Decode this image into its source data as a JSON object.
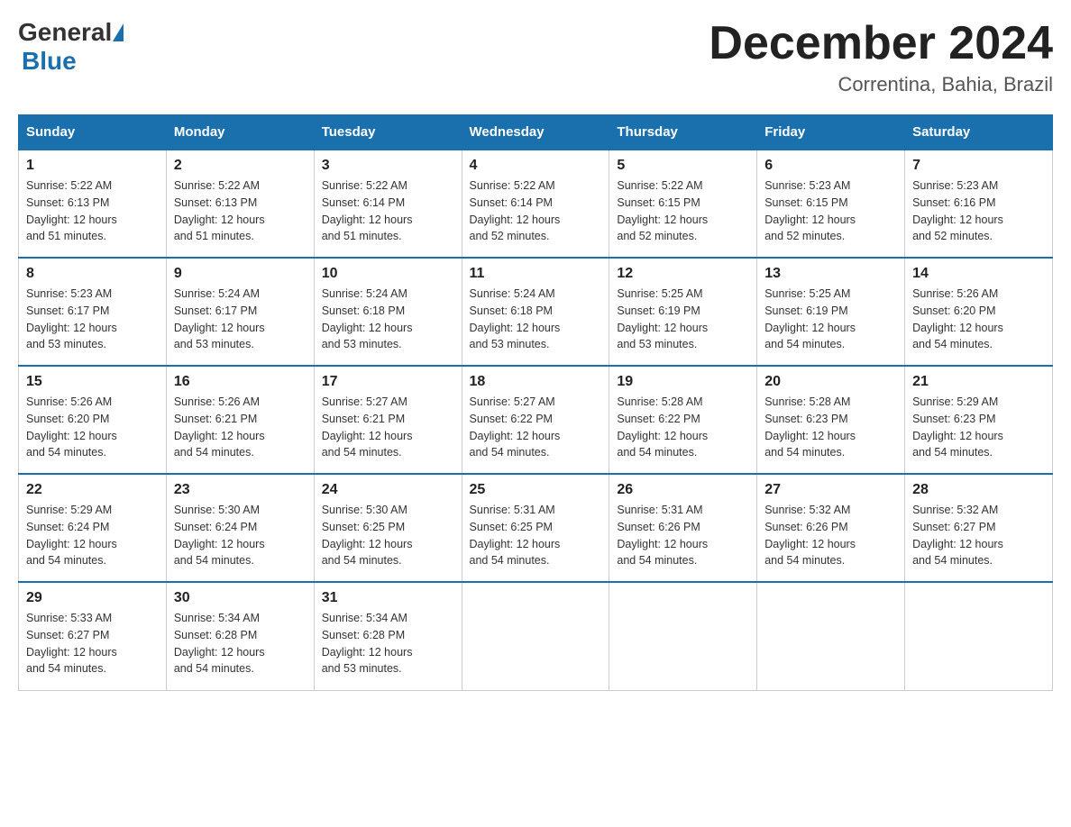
{
  "header": {
    "logo": {
      "general": "General",
      "blue": "Blue"
    },
    "title": "December 2024",
    "location": "Correntina, Bahia, Brazil"
  },
  "days_of_week": [
    "Sunday",
    "Monday",
    "Tuesday",
    "Wednesday",
    "Thursday",
    "Friday",
    "Saturday"
  ],
  "weeks": [
    [
      {
        "day": "1",
        "sunrise": "5:22 AM",
        "sunset": "6:13 PM",
        "daylight": "12 hours and 51 minutes."
      },
      {
        "day": "2",
        "sunrise": "5:22 AM",
        "sunset": "6:13 PM",
        "daylight": "12 hours and 51 minutes."
      },
      {
        "day": "3",
        "sunrise": "5:22 AM",
        "sunset": "6:14 PM",
        "daylight": "12 hours and 51 minutes."
      },
      {
        "day": "4",
        "sunrise": "5:22 AM",
        "sunset": "6:14 PM",
        "daylight": "12 hours and 52 minutes."
      },
      {
        "day": "5",
        "sunrise": "5:22 AM",
        "sunset": "6:15 PM",
        "daylight": "12 hours and 52 minutes."
      },
      {
        "day": "6",
        "sunrise": "5:23 AM",
        "sunset": "6:15 PM",
        "daylight": "12 hours and 52 minutes."
      },
      {
        "day": "7",
        "sunrise": "5:23 AM",
        "sunset": "6:16 PM",
        "daylight": "12 hours and 52 minutes."
      }
    ],
    [
      {
        "day": "8",
        "sunrise": "5:23 AM",
        "sunset": "6:17 PM",
        "daylight": "12 hours and 53 minutes."
      },
      {
        "day": "9",
        "sunrise": "5:24 AM",
        "sunset": "6:17 PM",
        "daylight": "12 hours and 53 minutes."
      },
      {
        "day": "10",
        "sunrise": "5:24 AM",
        "sunset": "6:18 PM",
        "daylight": "12 hours and 53 minutes."
      },
      {
        "day": "11",
        "sunrise": "5:24 AM",
        "sunset": "6:18 PM",
        "daylight": "12 hours and 53 minutes."
      },
      {
        "day": "12",
        "sunrise": "5:25 AM",
        "sunset": "6:19 PM",
        "daylight": "12 hours and 53 minutes."
      },
      {
        "day": "13",
        "sunrise": "5:25 AM",
        "sunset": "6:19 PM",
        "daylight": "12 hours and 54 minutes."
      },
      {
        "day": "14",
        "sunrise": "5:26 AM",
        "sunset": "6:20 PM",
        "daylight": "12 hours and 54 minutes."
      }
    ],
    [
      {
        "day": "15",
        "sunrise": "5:26 AM",
        "sunset": "6:20 PM",
        "daylight": "12 hours and 54 minutes."
      },
      {
        "day": "16",
        "sunrise": "5:26 AM",
        "sunset": "6:21 PM",
        "daylight": "12 hours and 54 minutes."
      },
      {
        "day": "17",
        "sunrise": "5:27 AM",
        "sunset": "6:21 PM",
        "daylight": "12 hours and 54 minutes."
      },
      {
        "day": "18",
        "sunrise": "5:27 AM",
        "sunset": "6:22 PM",
        "daylight": "12 hours and 54 minutes."
      },
      {
        "day": "19",
        "sunrise": "5:28 AM",
        "sunset": "6:22 PM",
        "daylight": "12 hours and 54 minutes."
      },
      {
        "day": "20",
        "sunrise": "5:28 AM",
        "sunset": "6:23 PM",
        "daylight": "12 hours and 54 minutes."
      },
      {
        "day": "21",
        "sunrise": "5:29 AM",
        "sunset": "6:23 PM",
        "daylight": "12 hours and 54 minutes."
      }
    ],
    [
      {
        "day": "22",
        "sunrise": "5:29 AM",
        "sunset": "6:24 PM",
        "daylight": "12 hours and 54 minutes."
      },
      {
        "day": "23",
        "sunrise": "5:30 AM",
        "sunset": "6:24 PM",
        "daylight": "12 hours and 54 minutes."
      },
      {
        "day": "24",
        "sunrise": "5:30 AM",
        "sunset": "6:25 PM",
        "daylight": "12 hours and 54 minutes."
      },
      {
        "day": "25",
        "sunrise": "5:31 AM",
        "sunset": "6:25 PM",
        "daylight": "12 hours and 54 minutes."
      },
      {
        "day": "26",
        "sunrise": "5:31 AM",
        "sunset": "6:26 PM",
        "daylight": "12 hours and 54 minutes."
      },
      {
        "day": "27",
        "sunrise": "5:32 AM",
        "sunset": "6:26 PM",
        "daylight": "12 hours and 54 minutes."
      },
      {
        "day": "28",
        "sunrise": "5:32 AM",
        "sunset": "6:27 PM",
        "daylight": "12 hours and 54 minutes."
      }
    ],
    [
      {
        "day": "29",
        "sunrise": "5:33 AM",
        "sunset": "6:27 PM",
        "daylight": "12 hours and 54 minutes."
      },
      {
        "day": "30",
        "sunrise": "5:34 AM",
        "sunset": "6:28 PM",
        "daylight": "12 hours and 54 minutes."
      },
      {
        "day": "31",
        "sunrise": "5:34 AM",
        "sunset": "6:28 PM",
        "daylight": "12 hours and 53 minutes."
      },
      null,
      null,
      null,
      null
    ]
  ],
  "labels": {
    "sunrise": "Sunrise:",
    "sunset": "Sunset:",
    "daylight": "Daylight:"
  }
}
